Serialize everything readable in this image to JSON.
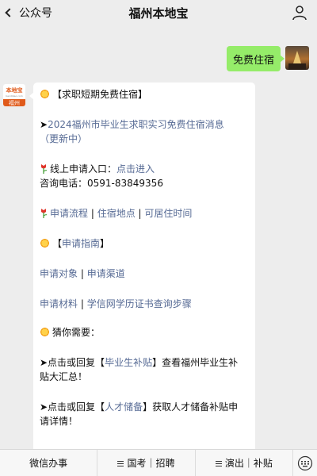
{
  "topbar": {
    "back_label": "公众号",
    "title": "福州本地宝"
  },
  "user_message": "免费住宿",
  "bot_avatar": {
    "brand": "本地宝",
    "site": "bendibao.com",
    "city": "福州"
  },
  "article": {
    "heading": "【求职短期免费住宿】",
    "news_arrow": "➤",
    "news_link_line1": "2024福州市毕业生求职实习免费住宿消息",
    "news_link_line2": "（更新中）",
    "apply_label": "线上申请入口：",
    "apply_link": "点击进入",
    "phone": "咨询电话：0591-83849356",
    "links_row": {
      "a": "申请流程",
      "sep1": " | ",
      "b": "住宿地点",
      "sep2": " | ",
      "c": "可居住时间"
    },
    "guide_heading_left": "【",
    "guide_heading_link": "申请指南",
    "guide_heading_right": "】",
    "guide_row1": {
      "a": "申请对象",
      "sep": "  |  ",
      "b": "申请渠道"
    },
    "guide_row2": {
      "a": "申请材料",
      "sep": "  |  ",
      "b": "学信网学历证书查询步骤"
    },
    "guess": "猜你需要：",
    "tip1_prefix": "➤点击或回复【",
    "tip1_link": "毕业生补贴",
    "tip1_suffix": "】查看福州毕业生补",
    "tip1_line2": "贴大汇总！",
    "tip2_prefix": "➤点击或回复【",
    "tip2_link": "人才储备",
    "tip2_suffix": "】获取人才储备补贴申",
    "tip2_line2": "请详情！"
  },
  "bottom_menu": {
    "item1": "微信办事",
    "item2": "国考｜招聘",
    "item3": "演出｜补贴"
  },
  "icons": {
    "back": "chevron-left-icon",
    "profile": "person-icon",
    "sun": "sun-emoji-icon",
    "flower": "tulip-emoji-icon",
    "keyboard": "keyboard-icon"
  },
  "colors": {
    "link": "#576b95",
    "user_bubble": "#95ec69",
    "brand": "#e05a1a"
  }
}
